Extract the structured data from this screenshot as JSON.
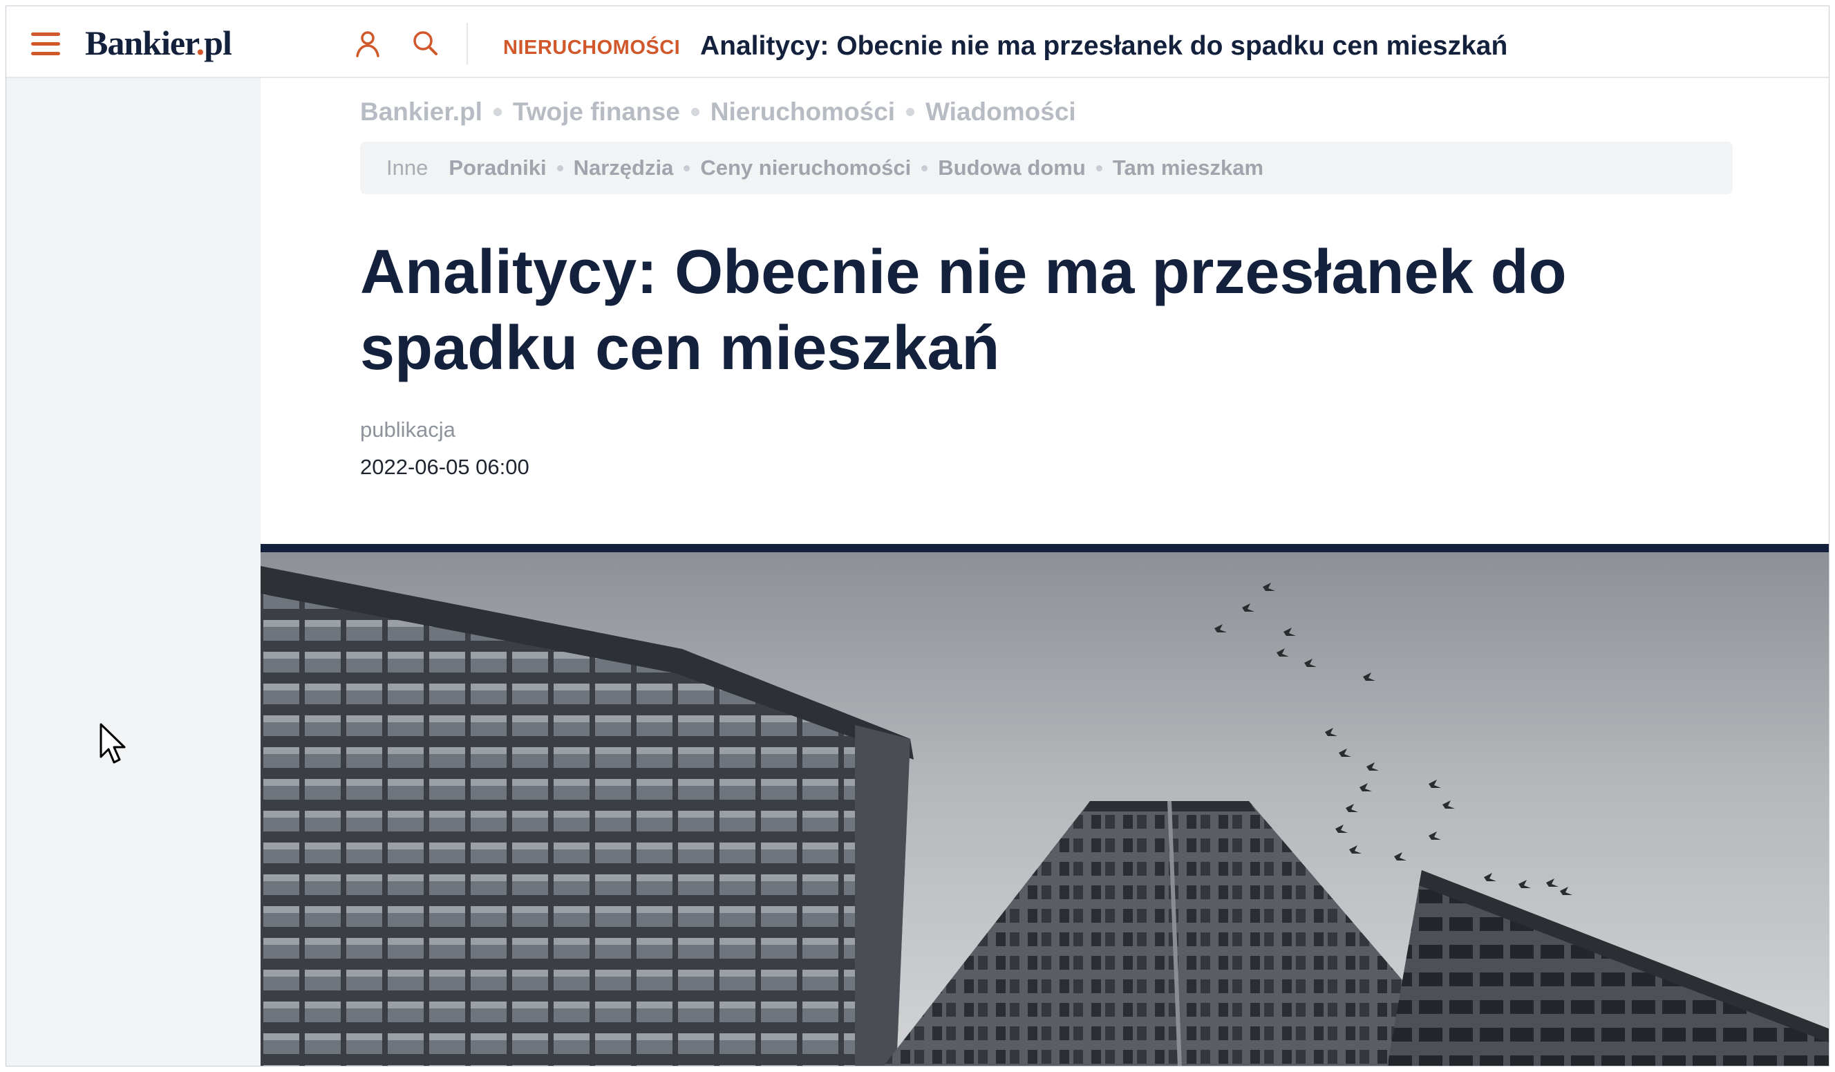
{
  "header": {
    "logo_main": "Bankier",
    "logo_dot": ".",
    "logo_tld": "pl",
    "section_tag": "NIERUCHOMOŚCI",
    "title": "Analitycy: Obecnie nie ma przesłanek do spadku cen mieszkań",
    "icons": [
      "menu-icon",
      "user-icon",
      "search-icon"
    ]
  },
  "breadcrumb": [
    "Bankier.pl",
    "Twoje finanse",
    "Nieruchomości",
    "Wiadomości"
  ],
  "subnav": {
    "label": "Inne",
    "items": [
      "Poradniki",
      "Narzędzia",
      "Ceny nieruchomości",
      "Budowa domu",
      "Tam mieszkam"
    ]
  },
  "article": {
    "title": "Analitycy: Obecnie nie ma przesłanek do spadku cen mieszkań",
    "publication_label": "publikacja",
    "publication_date": "2022-06-05 06:00"
  },
  "colors": {
    "accent": "#d1582b",
    "navy": "#14213d",
    "light_gray": "#f2f3f5"
  }
}
